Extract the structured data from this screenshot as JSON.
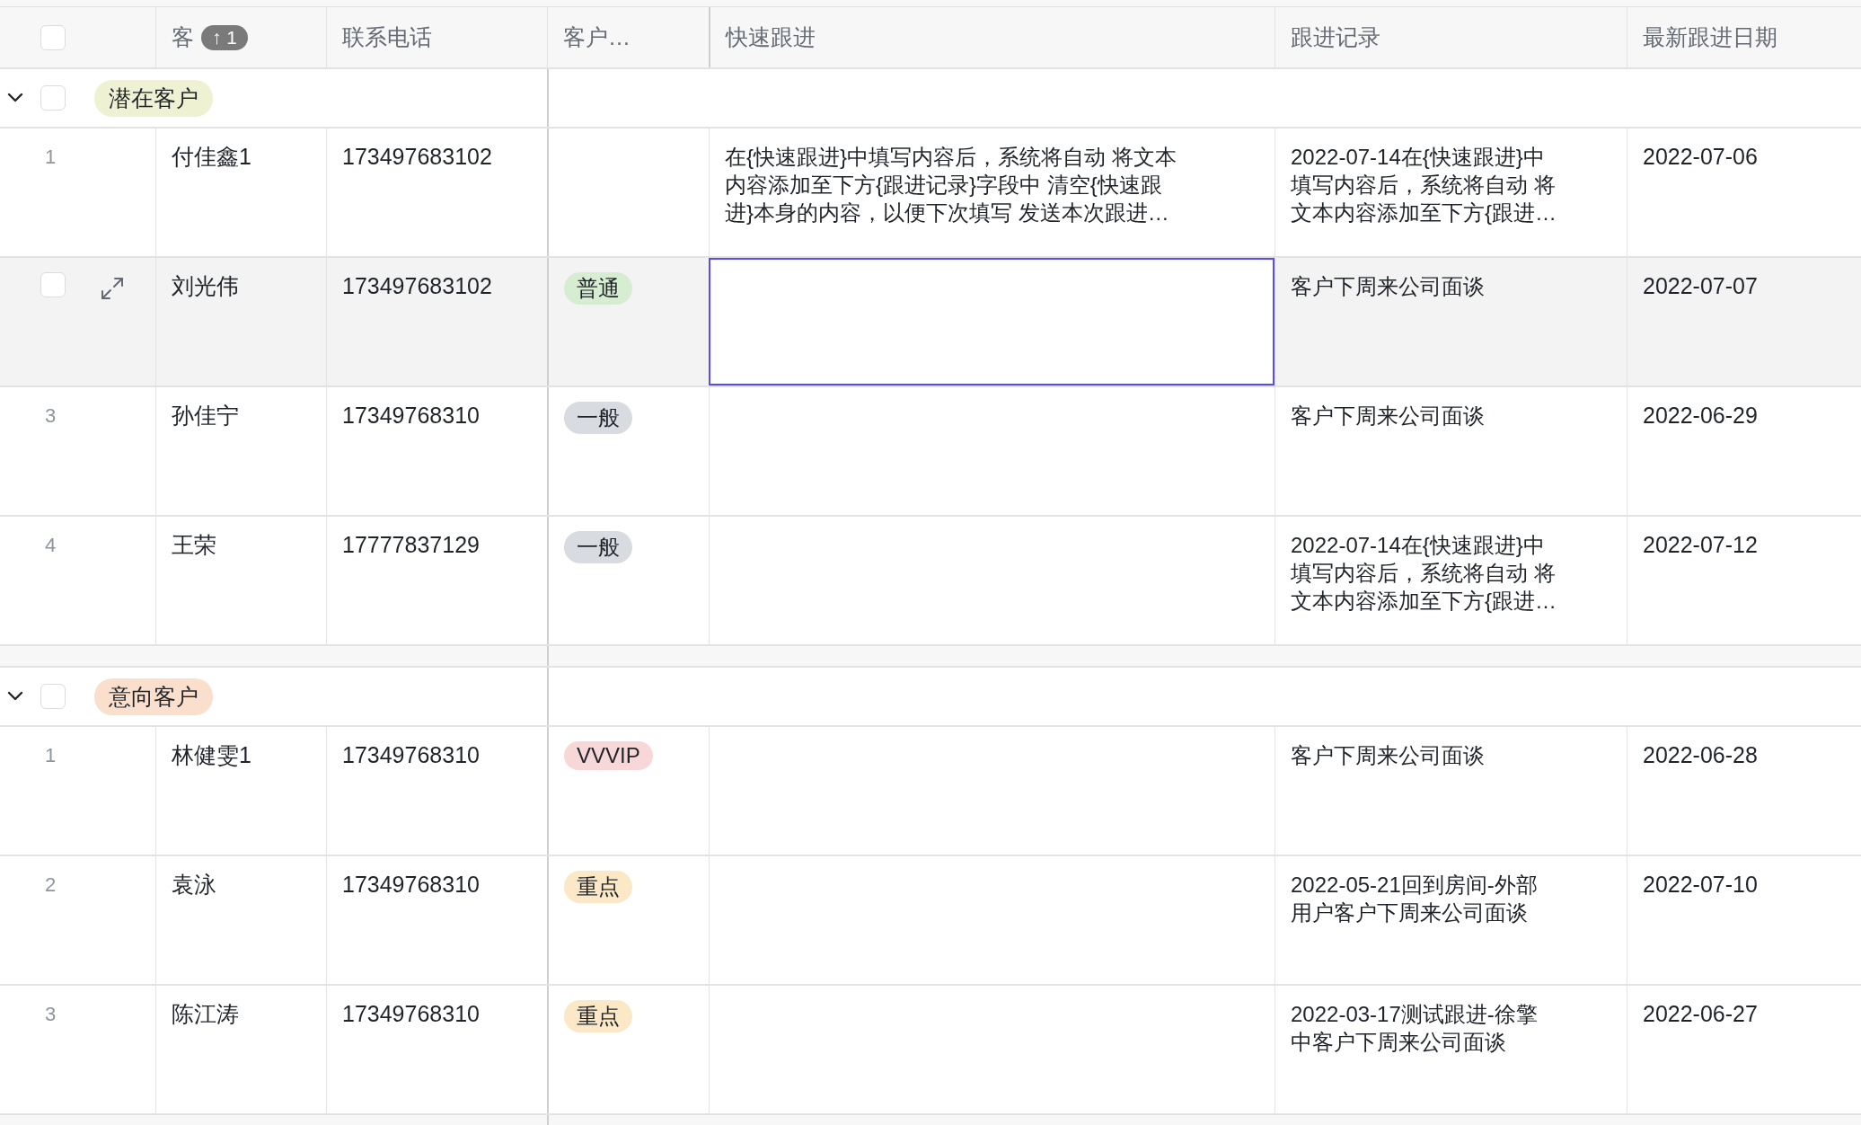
{
  "header": {
    "checked": false,
    "columns": [
      {
        "label": "客",
        "sort_badge": "↑ 1"
      },
      {
        "label": "联系电话"
      },
      {
        "label": "客户…"
      },
      {
        "label": "快速跟进"
      },
      {
        "label": "跟进记录"
      },
      {
        "label": "最新跟进日期"
      }
    ]
  },
  "groups": [
    {
      "label": "潜在客户",
      "color": "#eef2d3",
      "expanded": true,
      "checked": false,
      "rows": [
        {
          "index": "1",
          "hovered": false,
          "name": "付佳鑫1",
          "phone": "173497683102",
          "quick_follow": [
            "在{快速跟进}中填写内容后，系统将自动 将文本",
            "内容添加至下方{跟进记录}字段中 清空{快速跟",
            "进}本身的内容，以便下次填写 发送本次跟进…"
          ],
          "quick_follow_selected": false,
          "record": [
            "2022-07-14在{快速跟进}中",
            "填写内容后，系统将自动 将",
            "文本内容添加至下方{跟进…"
          ],
          "date": "2022-07-06"
        },
        {
          "hovered": true,
          "name": "刘光伟",
          "phone": "173497683102",
          "level": {
            "label": "普通",
            "color": "#d6edd1"
          },
          "quick_follow_selected": true,
          "record": [
            "客户下周来公司面谈"
          ],
          "date": "2022-07-07"
        },
        {
          "index": "3",
          "hovered": false,
          "name": "孙佳宁",
          "phone": "17349768310",
          "level": {
            "label": "一般",
            "color": "#d8dbe0"
          },
          "quick_follow_selected": false,
          "record": [
            "客户下周来公司面谈"
          ],
          "date": "2022-06-29"
        },
        {
          "index": "4",
          "hovered": false,
          "name": "王荣",
          "phone": "17777837129",
          "level": {
            "label": "一般",
            "color": "#d8dbe0"
          },
          "quick_follow_selected": false,
          "record": [
            "2022-07-14在{快速跟进}中",
            "填写内容后，系统将自动 将",
            "文本内容添加至下方{跟进…"
          ],
          "date": "2022-07-12"
        }
      ]
    },
    {
      "label": "意向客户",
      "color": "#fae0cc",
      "expanded": true,
      "checked": false,
      "rows": [
        {
          "index": "1",
          "hovered": false,
          "name": "林健雯1",
          "phone": "17349768310",
          "level": {
            "label": "VVVIP",
            "color": "#f7d7d7"
          },
          "quick_follow_selected": false,
          "record": [
            "客户下周来公司面谈"
          ],
          "date": "2022-06-28"
        },
        {
          "index": "2",
          "hovered": false,
          "name": "袁泳",
          "phone": "17349768310",
          "level": {
            "label": "重点",
            "color": "#fbe8c6"
          },
          "quick_follow_selected": false,
          "record": [
            "2022-05-21回到房间-外部",
            "用户客户下周来公司面谈"
          ],
          "date": "2022-07-10"
        },
        {
          "index": "3",
          "hovered": false,
          "name": "陈江涛",
          "phone": "17349768310",
          "level": {
            "label": "重点",
            "color": "#fbe8c6"
          },
          "quick_follow_selected": false,
          "record": [
            "2022-03-17测试跟进-徐擎",
            "中客户下周来公司面谈"
          ],
          "date": "2022-06-27"
        }
      ]
    }
  ]
}
